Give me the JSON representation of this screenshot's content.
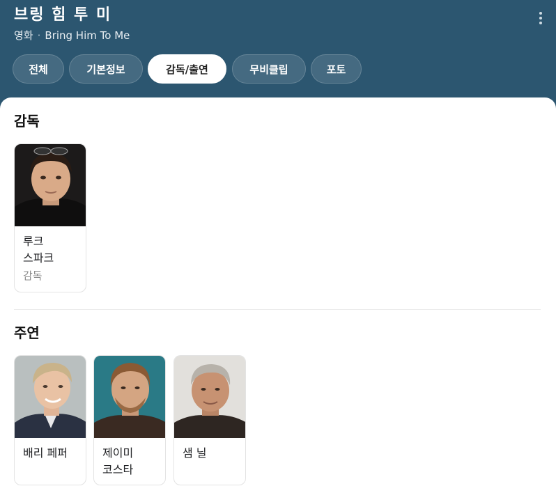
{
  "header": {
    "title": "브링 힘 투 미",
    "category": "영화",
    "original_title": "Bring Him To Me",
    "more_icon": "more-vert-icon",
    "background": "#2c5670"
  },
  "tabs": [
    {
      "label": "전체",
      "active": false
    },
    {
      "label": "기본정보",
      "active": false
    },
    {
      "label": "감독/출연",
      "active": true
    },
    {
      "label": "무비클립",
      "active": false
    },
    {
      "label": "포토",
      "active": false
    }
  ],
  "sections": {
    "director": {
      "title": "감독",
      "people": [
        {
          "name": "루크 스파크",
          "role": "감독"
        }
      ]
    },
    "cast": {
      "title": "주연",
      "people": [
        {
          "name": "배리 페퍼"
        },
        {
          "name": "제이미 코스타"
        },
        {
          "name": "샘 닐"
        }
      ]
    }
  }
}
